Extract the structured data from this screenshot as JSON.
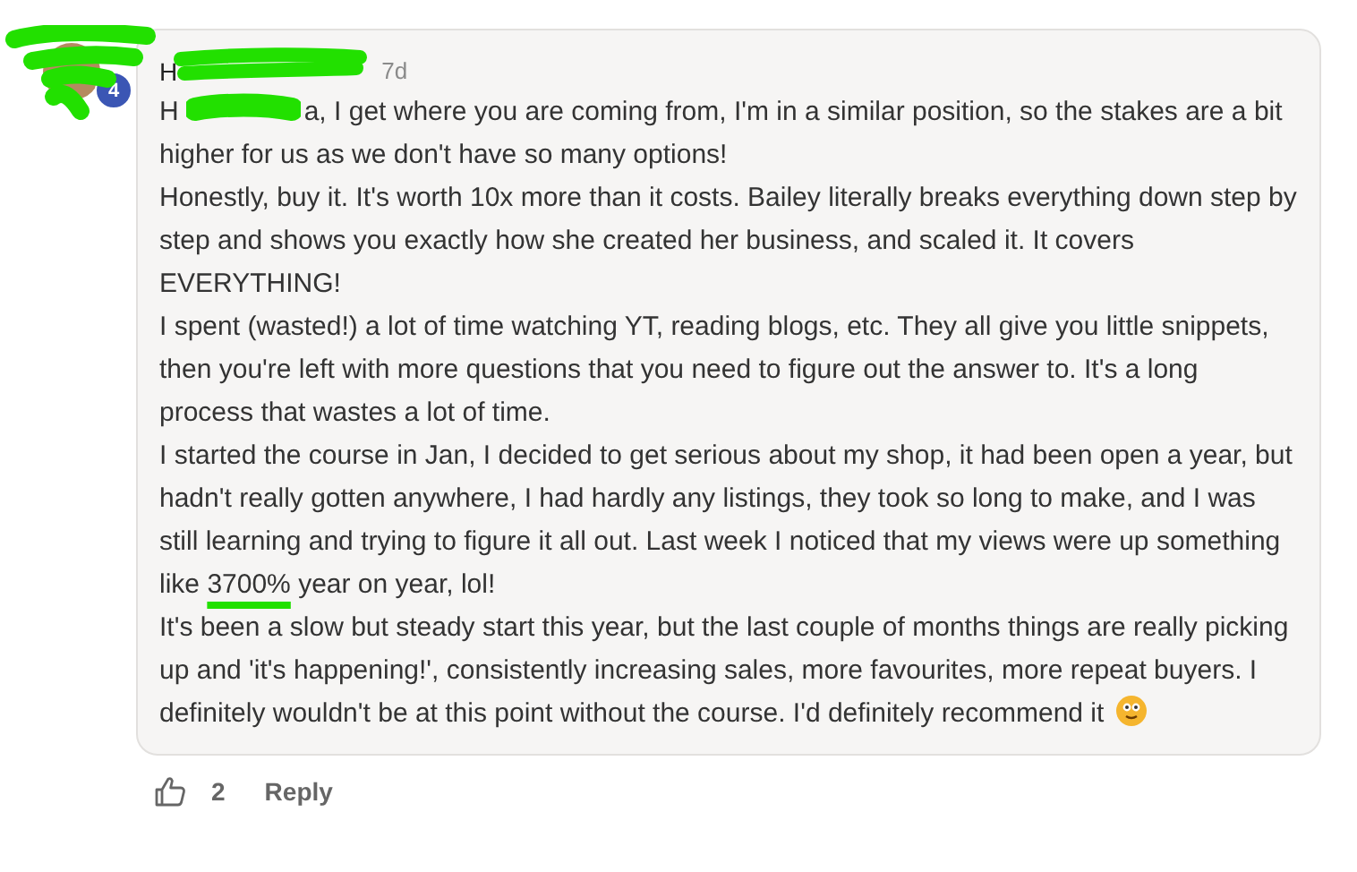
{
  "comment": {
    "author": "H",
    "badge": "4",
    "time": "7d",
    "paragraphs": [
      [
        {
          "kind": "text",
          "text": "H"
        },
        {
          "kind": "redaction"
        },
        {
          "kind": "text",
          "text": "a, I get where you are coming from, I'm in a similar position, so the stakes are a bit higher for us as we don't have so many options!"
        }
      ],
      [
        {
          "kind": "text",
          "text": "Honestly, buy it. It's worth 10x more than it costs. Bailey literally breaks everything down step by step and shows you exactly how she created her business, and scaled it. It covers EVERYTHING!"
        }
      ],
      [
        {
          "kind": "text",
          "text": "I spent (wasted!) a lot of time watching YT, reading blogs, etc. They all give you little snippets, then you're left with more questions that you need to figure out the answer to. It's a long process that wastes a lot of time."
        }
      ],
      [
        {
          "kind": "text",
          "text": "I started the course in Jan, I decided to get serious about my shop, it had been open a year, but hadn't really gotten anywhere, I had hardly any listings, they took so long to make, and I was still learning and trying to figure it all out. Last week I noticed that my views were up something like "
        },
        {
          "kind": "underlined",
          "text": "3700%"
        },
        {
          "kind": "text",
          "text": " year on year, lol!"
        }
      ],
      [
        {
          "kind": "text",
          "text": "It's been a slow but steady start this year, but the last couple of months things are really picking up and 'it's happening!', consistently increasing sales, more favourites, more repeat buyers. I definitely wouldn't be at this point without the course. I'd definitely recommend it"
        }
      ]
    ],
    "likes": "2",
    "reply": "Reply"
  }
}
